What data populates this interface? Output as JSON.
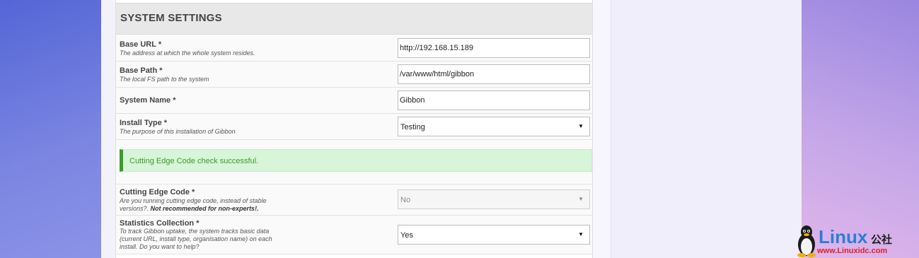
{
  "section": {
    "title": "SYSTEM SETTINGS"
  },
  "fields": {
    "base_url": {
      "label": "Base URL *",
      "description": "The address at which the whole system resides.",
      "value": "http://192.168.15.189"
    },
    "base_path": {
      "label": "Base Path *",
      "description": "The local FS path to the system",
      "value": "/var/www/html/gibbon"
    },
    "system_name": {
      "label": "System Name *",
      "value": "Gibbon"
    },
    "install_type": {
      "label": "Install Type *",
      "description": "The purpose of this installation of Gibbon",
      "value": "Testing"
    },
    "cutting_edge": {
      "label": "Cutting Edge Code *",
      "description_line1": "Are you running cutting edge code, instead of stable",
      "description_line2": "versions?.",
      "description_bold": "Not recommended for non-experts!.",
      "value": "No"
    },
    "statistics": {
      "label": "Statistics Collection *",
      "description_line1": "To track Gibbon uptake, the system tracks basic data",
      "description_line2": "(current URL, install type, organisation name) on each",
      "description_line3": "install. Do you want to help?",
      "value": "Yes"
    }
  },
  "alert": {
    "message": "Cutting Edge Code check successful."
  },
  "watermark": {
    "brand": "Linux",
    "cn": "公社",
    "url": "www.Linuxidc.com"
  }
}
